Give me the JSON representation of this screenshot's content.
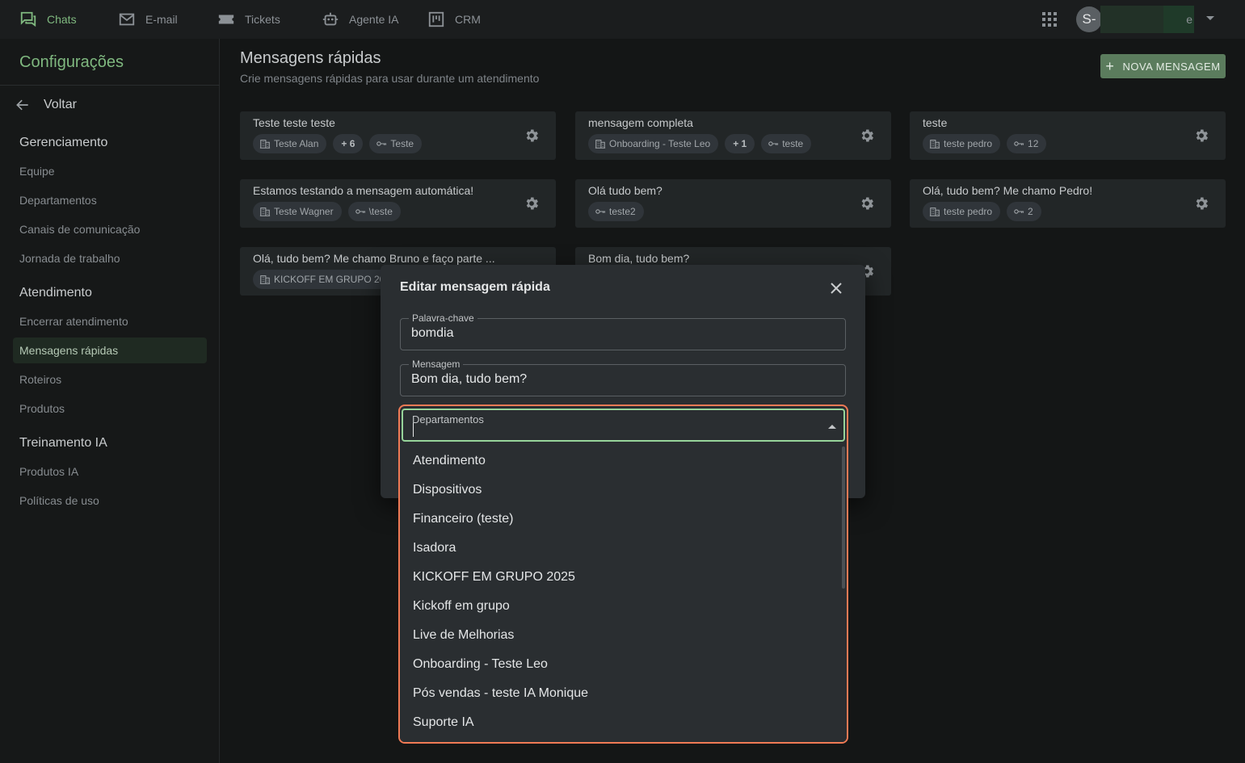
{
  "topnav": {
    "items": [
      {
        "label": "Chats",
        "icon": "chat-icon",
        "active": true
      },
      {
        "label": "E-mail",
        "icon": "mail-icon"
      },
      {
        "label": "Tickets",
        "icon": "ticket-icon"
      },
      {
        "label": "Agente IA",
        "icon": "robot-icon"
      },
      {
        "label": "CRM",
        "icon": "kanban-icon"
      }
    ],
    "avatar_initials": "S-",
    "user_name_suffix": "e"
  },
  "sidebar": {
    "title": "Configurações",
    "back_label": "Voltar",
    "sections": [
      {
        "title": "Gerenciamento",
        "items": [
          "Equipe",
          "Departamentos",
          "Canais de comunicação",
          "Jornada de trabalho"
        ]
      },
      {
        "title": "Atendimento",
        "items": [
          "Encerrar atendimento",
          "Mensagens rápidas",
          "Roteiros",
          "Produtos"
        ]
      },
      {
        "title": "Treinamento IA",
        "items": [
          "Produtos IA",
          "Políticas de uso"
        ]
      }
    ],
    "active_item": "Mensagens rápidas"
  },
  "main": {
    "title": "Mensagens rápidas",
    "subtitle": "Crie mensagens rápidas para usar durante um atendimento",
    "new_button": "NOVA MENSAGEM",
    "cards": [
      {
        "title": "Teste teste teste",
        "dept": "Teste Alan",
        "count": "+ 6",
        "keyword": "Teste"
      },
      {
        "title": "mensagem completa",
        "dept": "Onboarding - Teste Leo",
        "count": "+ 1",
        "keyword": "teste"
      },
      {
        "title": "teste",
        "dept": "teste pedro",
        "keyword": "12"
      },
      {
        "title": "Estamos testando a mensagem automática!",
        "dept": "Teste Wagner",
        "keyword": "\\teste"
      },
      {
        "title": "Olá tudo bem?",
        "keyword": "teste2"
      },
      {
        "title": "Olá, tudo bem? Me chamo Pedro!",
        "dept": "teste pedro",
        "keyword": "2"
      },
      {
        "title": "Olá, tudo bem? Me chamo Bruno e faço parte ...",
        "dept": "KICKOFF EM GRUPO 20"
      },
      {
        "title": "Bom dia, tudo bem?"
      }
    ]
  },
  "modal": {
    "title": "Editar mensagem rápida",
    "keyword_label": "Palavra-chave",
    "keyword_value": "bomdia",
    "message_label": "Mensagem",
    "message_value": "Bom dia, tudo bem?",
    "departments_label": "Departamentos",
    "departments_options": [
      "Atendimento",
      "Dispositivos",
      "Financeiro (teste)",
      "Isadora",
      "KICKOFF EM GRUPO 2025",
      "Kickoff em grupo",
      "Live de Melhorias",
      "Onboarding - Teste Leo",
      "Pós vendas - teste IA Monique",
      "Suporte IA"
    ]
  },
  "colors": {
    "accent": "#7fb87f",
    "button": "#5b7c5d",
    "highlight_border": "#f07a55",
    "focus_border": "#96d49a"
  }
}
